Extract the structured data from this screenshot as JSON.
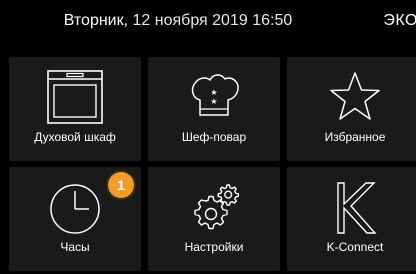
{
  "status": {
    "weekday": "Вторник,",
    "date": "12 ноября 2019",
    "time": "16:50",
    "mode": "ЭКО"
  },
  "tiles": [
    {
      "label": "Духовой шкаф",
      "icon": "oven-icon"
    },
    {
      "label": "Шеф-повар",
      "icon": "chef-hat-icon"
    },
    {
      "label": "Избранное",
      "icon": "star-icon"
    },
    {
      "label": "Часы",
      "icon": "clock-icon",
      "badge": "1"
    },
    {
      "label": "Настройки",
      "icon": "gears-icon"
    },
    {
      "label": "K-Connect",
      "icon": "k-connect-icon"
    }
  ],
  "colors": {
    "background": "#000000",
    "tile": "#1a1a1a",
    "badge": "#f39a2e",
    "text": "#ffffff"
  }
}
